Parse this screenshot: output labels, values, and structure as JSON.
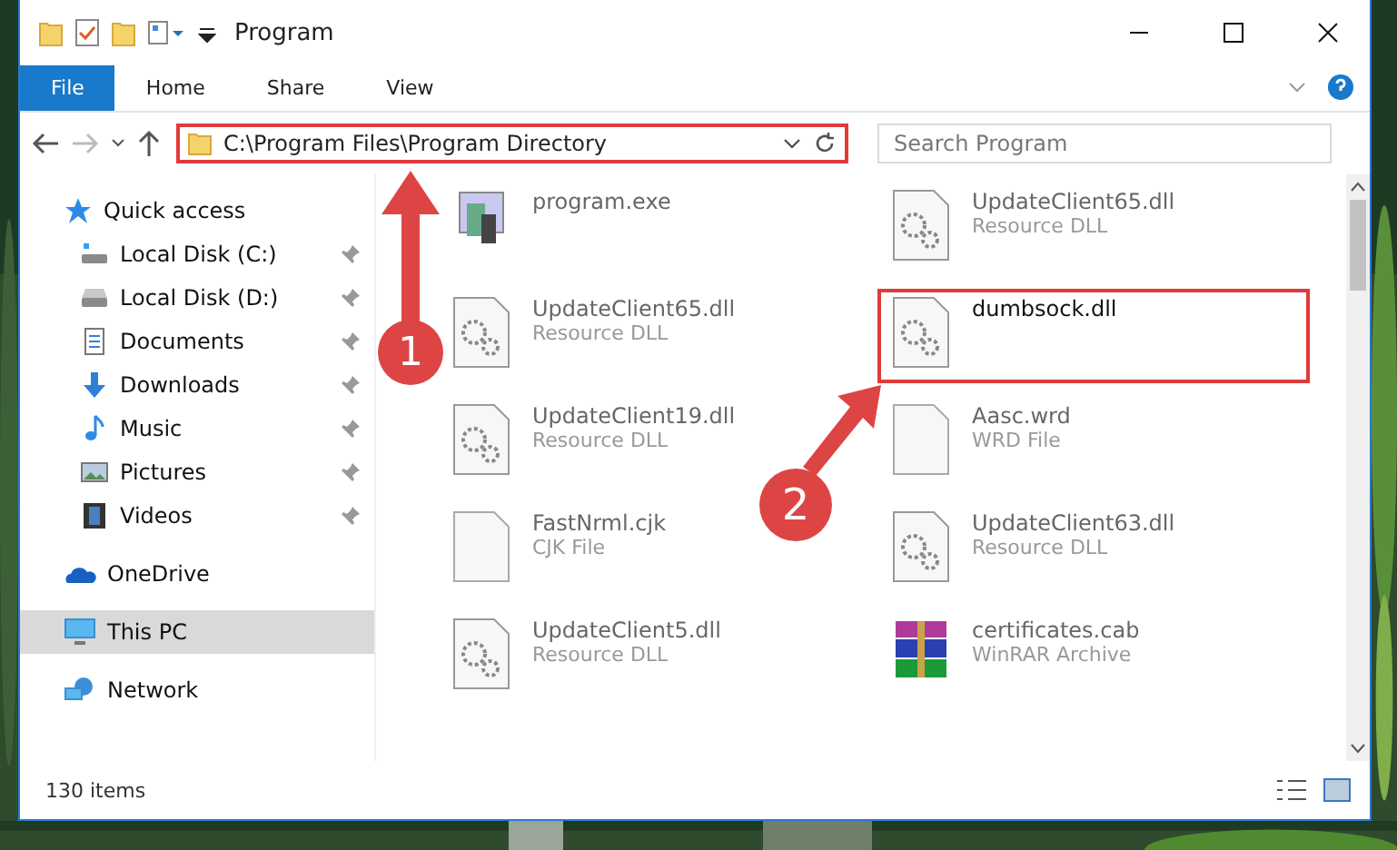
{
  "window": {
    "title": "Program"
  },
  "ribbon_tabs": [
    {
      "label": "File",
      "selected": true
    },
    {
      "label": "Home",
      "selected": false
    },
    {
      "label": "Share",
      "selected": false
    },
    {
      "label": "View",
      "selected": false
    }
  ],
  "address": {
    "path": "C:\\Program Files\\Program Directory",
    "highlighted": true
  },
  "search": {
    "placeholder": "Search Program"
  },
  "sidebar": {
    "items": [
      {
        "label": "Quick access",
        "pinned": false,
        "selected": false,
        "children": [
          {
            "label": "Local Disk (C:)",
            "pinned": true,
            "selected": false
          },
          {
            "label": "Local Disk (D:)",
            "pinned": true,
            "selected": false
          },
          {
            "label": "Documents",
            "pinned": true,
            "selected": false
          },
          {
            "label": "Downloads",
            "pinned": true,
            "selected": false
          },
          {
            "label": "Music",
            "pinned": true,
            "selected": false
          },
          {
            "label": "Pictures",
            "pinned": true,
            "selected": false
          },
          {
            "label": "Videos",
            "pinned": true,
            "selected": false
          }
        ]
      },
      {
        "label": "OneDrive",
        "pinned": false,
        "selected": false
      },
      {
        "label": "This PC",
        "pinned": false,
        "selected": true
      },
      {
        "label": "Network",
        "pinned": false,
        "selected": false
      }
    ]
  },
  "files": [
    {
      "name": "program.exe",
      "kind": "program",
      "highlighted": false
    },
    {
      "name": "UpdateClient65.dll",
      "type": "Resource DLL",
      "kind": "dll",
      "highlighted": false
    },
    {
      "name": "UpdateClient65.dll",
      "type": "Resource DLL",
      "kind": "dll",
      "highlighted": false
    },
    {
      "name": "dumbsock.dll",
      "kind": "dll",
      "highlighted": true
    },
    {
      "name": "UpdateClient19.dll",
      "type": "Resource DLL",
      "kind": "dll",
      "highlighted": false
    },
    {
      "name": "Aasc.wrd",
      "type": "WRD File",
      "kind": "file",
      "highlighted": false
    },
    {
      "name": "FastNrml.cjk",
      "type": "CJK File",
      "kind": "file",
      "highlighted": false
    },
    {
      "name": "UpdateClient63.dll",
      "type": "Resource DLL",
      "kind": "dll",
      "highlighted": false
    },
    {
      "name": "UpdateClient5.dll",
      "type": "Resource DLL",
      "kind": "dll",
      "highlighted": false
    },
    {
      "name": "certificates.cab",
      "type": "WinRAR Archive",
      "kind": "archive",
      "highlighted": false
    }
  ],
  "status_bar": {
    "count": "130 items"
  },
  "callouts": [
    {
      "number": "1"
    },
    {
      "number": "2"
    }
  ]
}
